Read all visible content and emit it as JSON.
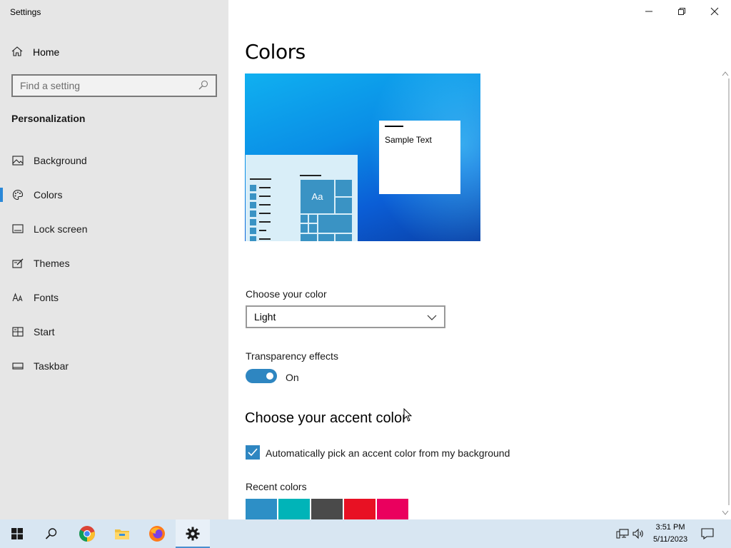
{
  "window": {
    "title": "Settings",
    "controls": [
      "minimize",
      "restore",
      "close"
    ]
  },
  "sidebar": {
    "home_label": "Home",
    "search_placeholder": "Find a setting",
    "section_heading": "Personalization",
    "items": [
      {
        "label": "Background",
        "icon": "image-icon",
        "selected": false
      },
      {
        "label": "Colors",
        "icon": "palette-icon",
        "selected": true
      },
      {
        "label": "Lock screen",
        "icon": "lock-screen-icon",
        "selected": false
      },
      {
        "label": "Themes",
        "icon": "themes-icon",
        "selected": false
      },
      {
        "label": "Fonts",
        "icon": "fonts-icon",
        "selected": false
      },
      {
        "label": "Start",
        "icon": "start-icon",
        "selected": false
      },
      {
        "label": "Taskbar",
        "icon": "taskbar-icon",
        "selected": false
      }
    ]
  },
  "main": {
    "title": "Colors",
    "preview": {
      "sample_text": "Sample Text",
      "tile_label": "Aa"
    },
    "choose_color": {
      "label": "Choose your color",
      "value": "Light"
    },
    "transparency": {
      "label": "Transparency effects",
      "state": "On",
      "enabled": true
    },
    "accent": {
      "heading": "Choose your accent color",
      "auto_pick_label": "Automatically pick an accent color from my background",
      "auto_pick_checked": true,
      "recent_label": "Recent colors",
      "recent_colors": [
        "#2d8fc6",
        "#00b4b8",
        "#4a4a4a",
        "#e81123",
        "#ea005e"
      ]
    }
  },
  "taskbar": {
    "apps": [
      "start-icon",
      "search-icon",
      "chrome-icon",
      "file-explorer-icon",
      "firefox-icon",
      "settings-gear-icon"
    ],
    "active_app": "settings-gear-icon",
    "time": "3:51 PM",
    "date": "5/11/2023"
  },
  "colors": {
    "accent": "#2e86c1",
    "sidebar_bg": "#e6e6e6",
    "taskbar_bg": "#d8e6f2"
  }
}
